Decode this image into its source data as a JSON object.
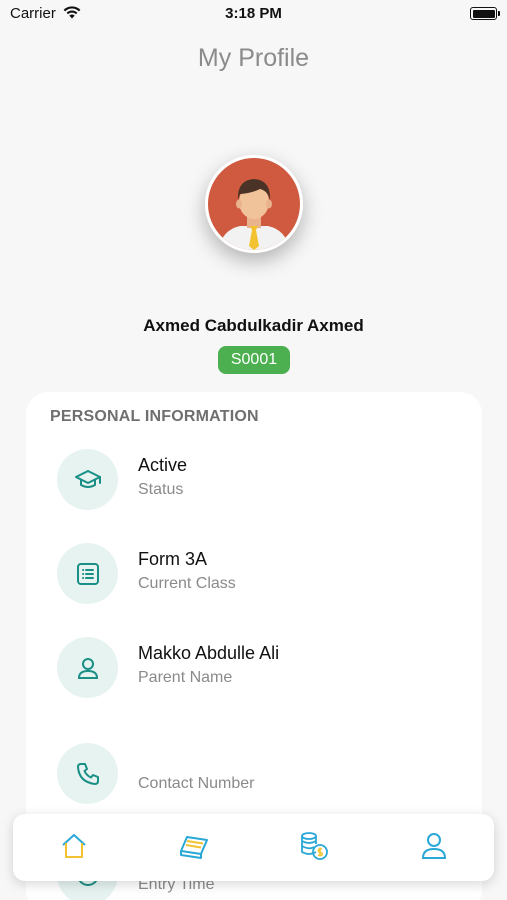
{
  "status_bar": {
    "carrier": "Carrier",
    "time": "3:18 PM"
  },
  "header": {
    "title": "My Profile"
  },
  "profile": {
    "name": "Axmed Cabdulkadir Axmed",
    "student_id": "S0001"
  },
  "personal_info": {
    "heading": "PERSONAL INFORMATION",
    "items": [
      {
        "icon": "graduation-cap-icon",
        "value": "Active",
        "label": "Status"
      },
      {
        "icon": "class-list-icon",
        "value": "Form 3A",
        "label": "Current Class"
      },
      {
        "icon": "user-icon",
        "value": "Makko Abdulle Ali",
        "label": "Parent Name"
      },
      {
        "icon": "phone-icon",
        "value": "",
        "label": "Contact Number"
      },
      {
        "icon": "clock-icon",
        "value": "",
        "label": "Entry Time"
      }
    ]
  },
  "bottom_nav": {
    "items": [
      {
        "icon": "home-icon"
      },
      {
        "icon": "book-icon"
      },
      {
        "icon": "coins-icon"
      },
      {
        "icon": "profile-icon"
      }
    ]
  },
  "colors": {
    "accent": "#1a8f85",
    "badge": "#4caf50",
    "icon_bg": "#e6f3f1",
    "nav_icon": "#29a8d6",
    "nav_icon_secondary": "#f2c230"
  }
}
